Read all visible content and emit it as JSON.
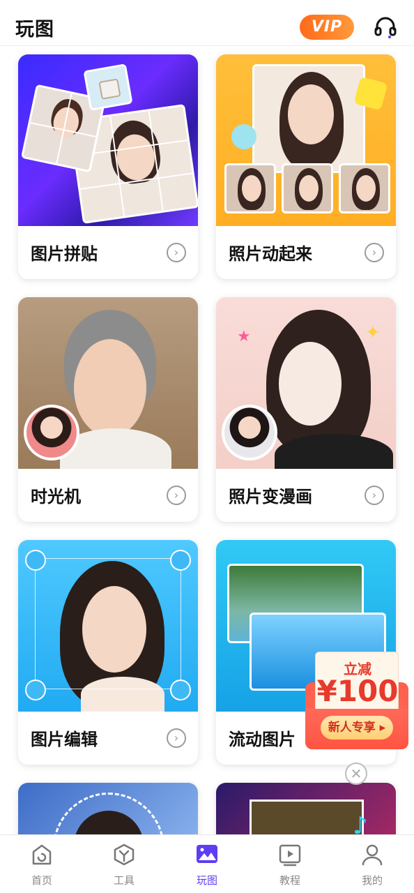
{
  "header": {
    "title": "玩图",
    "vip_label": "VIP",
    "support_icon": "headset-icon"
  },
  "cards": [
    {
      "label": "图片拼贴",
      "icon": "chevron-right-icon"
    },
    {
      "label": "照片动起来",
      "icon": "chevron-right-icon"
    },
    {
      "label": "时光机",
      "icon": "chevron-right-icon"
    },
    {
      "label": "照片变漫画",
      "icon": "chevron-right-icon"
    },
    {
      "label": "图片编辑",
      "icon": "chevron-right-icon"
    },
    {
      "label": "流动图片",
      "icon": "chevron-right-icon"
    }
  ],
  "promo": {
    "line1": "立减",
    "amount": "¥100",
    "button": "新人专享 ▸"
  },
  "tabs": [
    {
      "label": "首页",
      "icon": "home-icon"
    },
    {
      "label": "工具",
      "icon": "tools-icon"
    },
    {
      "label": "玩图",
      "icon": "image-play-icon",
      "active": true
    },
    {
      "label": "教程",
      "icon": "video-tutorial-icon"
    },
    {
      "label": "我的",
      "icon": "profile-icon"
    }
  ],
  "colors": {
    "accent": "#5e3df2",
    "vip": "#ff7a22",
    "promo_red": "#ff5a47"
  }
}
